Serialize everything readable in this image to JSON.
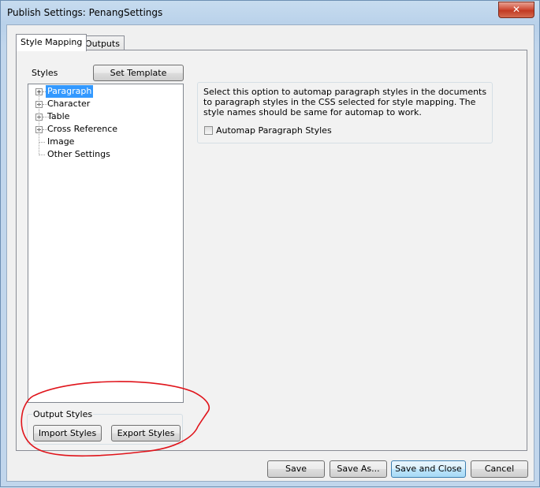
{
  "window": {
    "title": "Publish Settings: PenangSettings",
    "close_glyph": "✕"
  },
  "tabs": [
    {
      "label": "Style Mapping",
      "active": true
    },
    {
      "label": "Outputs",
      "active": false
    }
  ],
  "styles_panel": {
    "heading": "Styles",
    "set_template_label": "Set Template",
    "tree": [
      {
        "label": "Paragraph",
        "expandable": true,
        "selected": true
      },
      {
        "label": "Character",
        "expandable": true,
        "selected": false
      },
      {
        "label": "Table",
        "expandable": true,
        "selected": false
      },
      {
        "label": "Cross Reference",
        "expandable": true,
        "selected": false
      },
      {
        "label": "Image",
        "expandable": false,
        "selected": false
      },
      {
        "label": "Other Settings",
        "expandable": false,
        "selected": false
      }
    ],
    "expander_glyph": "+"
  },
  "details_panel": {
    "description": "Select this option to automap paragraph styles in the documents to paragraph styles in the CSS selected for style mapping. The style names should be same for automap to work.",
    "checkbox_label": "Automap Paragraph Styles",
    "checkbox_checked": false
  },
  "output_styles": {
    "heading": "Output Styles",
    "import_label": "Import Styles",
    "export_label": "Export Styles"
  },
  "footer": {
    "save_label": "Save",
    "save_as_label": "Save As...",
    "save_and_close_label": "Save and Close",
    "cancel_label": "Cancel"
  },
  "colors": {
    "selection": "#3399ff",
    "annotation": "#e0141b"
  }
}
